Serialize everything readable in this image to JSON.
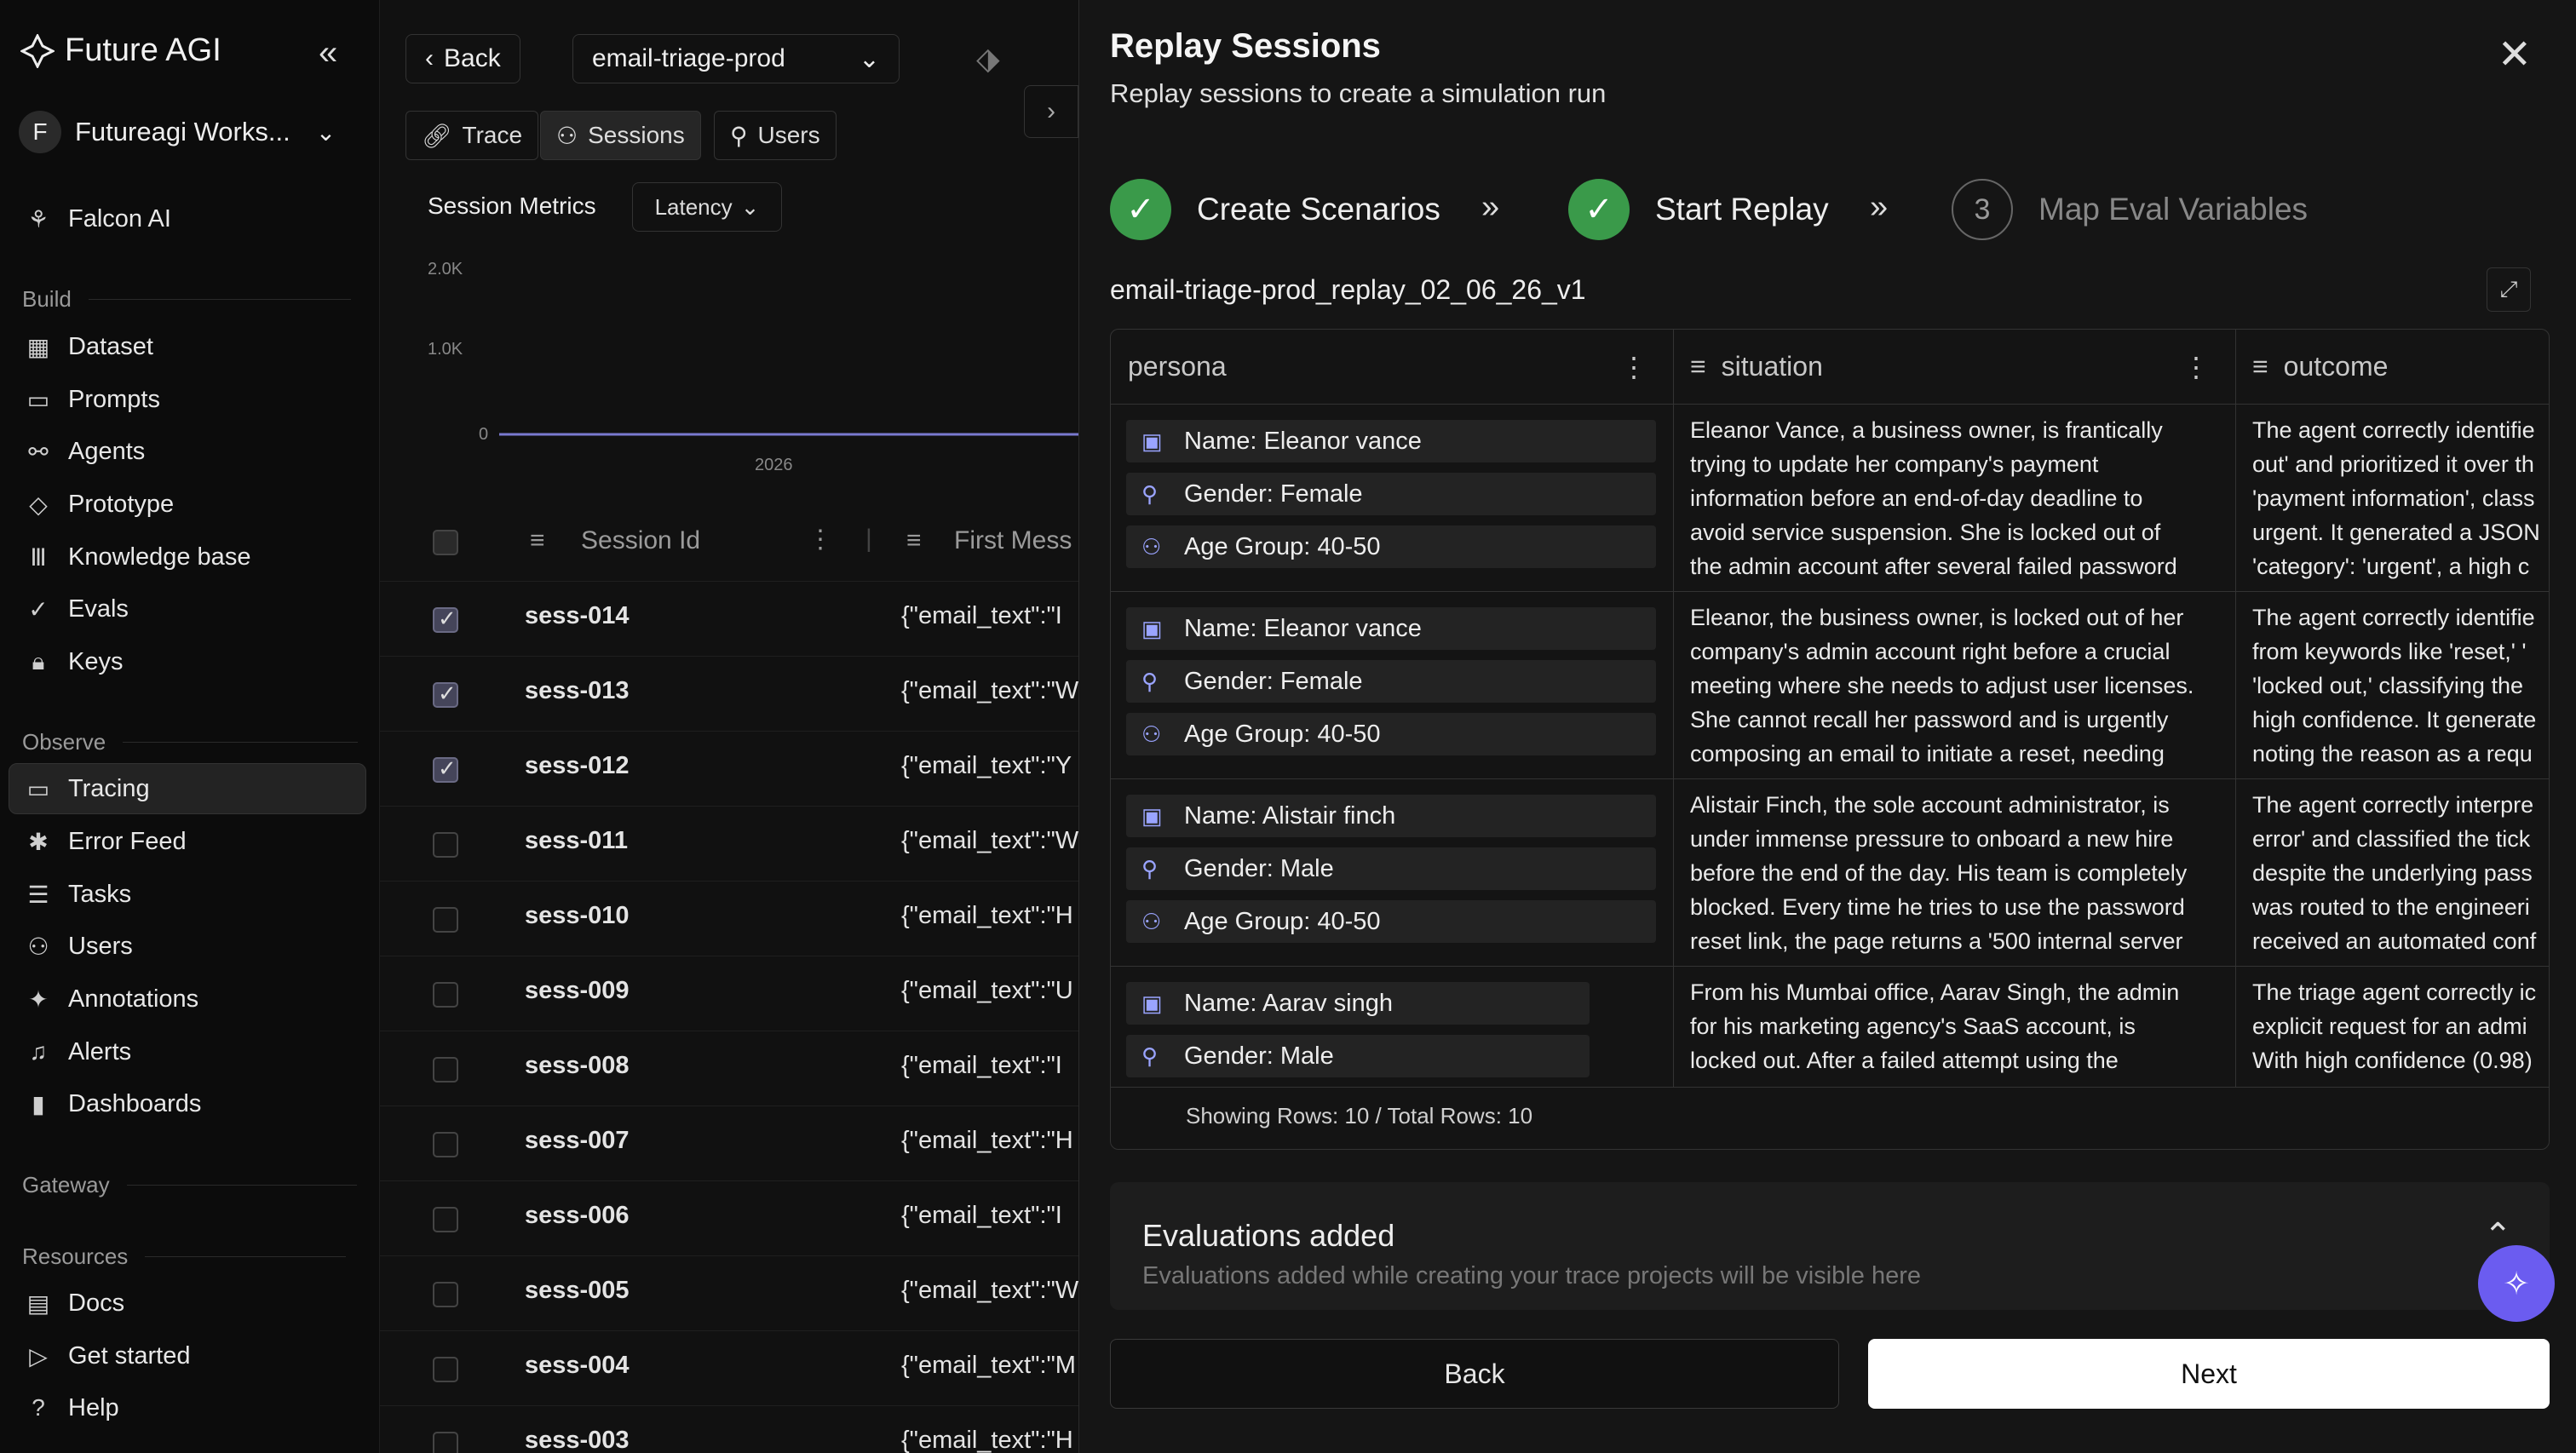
{
  "app": {
    "name": "Future AGI",
    "workspace": "Futureagi Works...",
    "workspace_initial": "F"
  },
  "sidebar": {
    "top_item": "Falcon AI",
    "build_label": "Build",
    "build": [
      "Dataset",
      "Prompts",
      "Agents",
      "Prototype",
      "Knowledge base",
      "Evals",
      "Keys"
    ],
    "observe_label": "Observe",
    "observe": [
      "Tracing",
      "Error Feed",
      "Tasks",
      "Users",
      "Annotations",
      "Alerts",
      "Dashboards"
    ],
    "gateway_label": "Gateway",
    "resources_label": "Resources",
    "resources": [
      "Docs",
      "Get started",
      "Help"
    ]
  },
  "center": {
    "back_label": "Back",
    "project": "email-triage-prod",
    "tabs": [
      "Trace",
      "Sessions",
      "Users"
    ],
    "metrics_label": "Session Metrics",
    "metric_select": "Latency",
    "y_ticks": [
      "2.0K",
      "1.0K",
      "0"
    ],
    "x_tick": "2026",
    "col_session": "Session Id",
    "col_first": "First Mess",
    "rows": [
      {
        "id": "sess-014",
        "first": "{\"email_text\":\"I",
        "checked": true
      },
      {
        "id": "sess-013",
        "first": "{\"email_text\":\"W",
        "checked": true
      },
      {
        "id": "sess-012",
        "first": "{\"email_text\":\"Y",
        "checked": true
      },
      {
        "id": "sess-011",
        "first": "{\"email_text\":\"W",
        "checked": false
      },
      {
        "id": "sess-010",
        "first": "{\"email_text\":\"H",
        "checked": false
      },
      {
        "id": "sess-009",
        "first": "{\"email_text\":\"U",
        "checked": false
      },
      {
        "id": "sess-008",
        "first": "{\"email_text\":\"I",
        "checked": false
      },
      {
        "id": "sess-007",
        "first": "{\"email_text\":\"H",
        "checked": false
      },
      {
        "id": "sess-006",
        "first": "{\"email_text\":\"I",
        "checked": false
      },
      {
        "id": "sess-005",
        "first": "{\"email_text\":\"W",
        "checked": false
      },
      {
        "id": "sess-004",
        "first": "{\"email_text\":\"M",
        "checked": false
      },
      {
        "id": "sess-003",
        "first": "{\"email_text\":\"H",
        "checked": false
      }
    ]
  },
  "panel": {
    "title": "Replay Sessions",
    "subtitle": "Replay sessions to create a simulation run",
    "steps": [
      "Create Scenarios",
      "Start Replay",
      "Map Eval Variables"
    ],
    "step3_number": "3",
    "dataset_name": "email-triage-prod_replay_02_06_26_v1",
    "columns": [
      "persona",
      "situation",
      "outcome"
    ],
    "grid_rows": [
      {
        "persona": [
          "Name: Eleanor vance",
          "Gender: Female",
          "Age Group: 40-50"
        ],
        "situation": [
          "Eleanor Vance, a business owner, is frantically",
          "trying to update her company's payment",
          "information before an end-of-day deadline to",
          "avoid service suspension. She is locked out of",
          "the admin account after several failed password"
        ],
        "outcome": [
          "The agent correctly identifie",
          "out' and prioritized it over th",
          "'payment information', class",
          "urgent. It generated a JSON",
          "'category': 'urgent', a high c"
        ]
      },
      {
        "persona": [
          "Name: Eleanor vance",
          "Gender: Female",
          "Age Group: 40-50"
        ],
        "situation": [
          "Eleanor, the business owner, is locked out of her",
          "company's admin account right before a crucial",
          "meeting where she needs to adjust user licenses.",
          "She cannot recall her password and is urgently",
          "composing an email to initiate a reset, needing"
        ],
        "outcome": [
          "The agent correctly identifie",
          "from keywords like 'reset,' '",
          "'locked out,' classifying the",
          "high confidence. It generate",
          "noting the reason as a requ"
        ]
      },
      {
        "persona": [
          "Name: Alistair finch",
          "Gender: Male",
          "Age Group: 40-50"
        ],
        "situation": [
          "Alistair Finch, the sole account administrator, is",
          "under immense pressure to onboard a new hire",
          "before the end of the day. His team is completely",
          "blocked. Every time he tries to use the password",
          "reset link, the page returns a '500 internal server"
        ],
        "outcome": [
          "The agent correctly interpre",
          "error' and classified the tick",
          "despite the underlying pass",
          "was routed to the engineeri",
          "received an automated conf"
        ]
      },
      {
        "persona": [
          "Name: Aarav singh",
          "Gender: Male"
        ],
        "situation": [
          "From his Mumbai office, Aarav Singh, the admin",
          "for his marketing agency's SaaS account, is",
          "locked out. After a failed attempt using the"
        ],
        "outcome": [
          "The triage agent correctly ic",
          "explicit request for an admi",
          "With high confidence (0.98)"
        ]
      }
    ],
    "rows_footer": "Showing Rows: 10 / Total Rows: 10",
    "evals_title": "Evaluations added",
    "evals_sub": "Evaluations added while creating your trace projects will be visible here",
    "back_label": "Back",
    "next_label": "Next"
  }
}
